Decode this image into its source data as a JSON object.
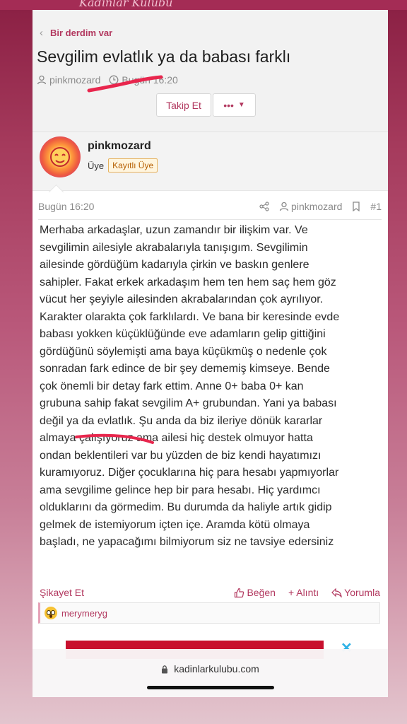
{
  "header": {
    "brand_text": "Kadınlar Kulübü",
    "breadcrumb": "Bir derdim var",
    "title": "Sevgilim evlatlık ya da babası farklı",
    "author": "pinkmozard",
    "time": "Bugün 16:20",
    "follow_label": "Takip Et",
    "more_label": "•••"
  },
  "user": {
    "name": "pinkmozard",
    "role": "Üye",
    "badge": "Kayıtlı Üye"
  },
  "post": {
    "time": "Bugün 16:20",
    "author": "pinkmozard",
    "number": "#1",
    "lines": [
      "Merhaba arkadaşlar, uzun zamandır bir ilişkim var. Ve",
      "sevgilimin ailesiyle akrabalarıyla tanışıgım. Sevgilimin",
      "ailesinde gördüğüm kadarıyla çirkin ve baskın genlere",
      "sahipler. Fakat erkek arkadaşım hem ten hem saç hem göz",
      "vücut her şeyiyle ailesinden akrabalarından çok ayrılıyor.",
      "Karakter olarakta çok farklılardı. Ve bana bir keresinde evde",
      "babası yokken küçüklüğünde eve adamların gelip gittiğini",
      "gördüğünü söylemişti ama baya küçükmüş o nedenle çok",
      "sonradan fark edince de bir şey dememiş kimseye. Bende",
      "çok önemli bir detay fark ettim. Anne 0+ baba 0+ kan",
      "grubuna sahip fakat sevgilim A+ grubundan. Yani ya babası",
      "değil ya da evlatlık. Şu anda da biz ileriye dönük kararlar",
      "almaya çalışıyoruz ama ailesi hiç destek olmuyor hatta",
      "ondan beklentileri var bu yüzden de biz kendi hayatımızı",
      "kuramıyoruz. Diğer çocuklarına hiç para hesabı yapmıyorlar",
      "ama sevgilime gelince hep bir para hesabı. Hiç yardımcı",
      "olduklarını da görmedim. Bu durumda da haliyle artık gidip",
      "gelmek de istemiyorum içten içe. Aramda kötü olmaya",
      "başladı, ne yapacağımı bilmiyorum siz ne tavsiye edersiniz"
    ]
  },
  "actions": {
    "report": "Şikayet Et",
    "like": "Beğen",
    "quote": "+ Alıntı",
    "reply": "Yorumla"
  },
  "reactions": {
    "users": "merymeryg"
  },
  "browser": {
    "url": "kadinlarkulubu.com"
  },
  "colors": {
    "accent": "#b2385f",
    "ink": "#e8264d"
  }
}
